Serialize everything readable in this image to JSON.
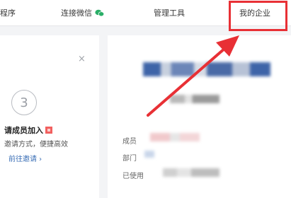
{
  "topbar": {
    "nav_miniprogram": "程序",
    "nav_wechat": "连接微信",
    "nav_tools": "管理工具",
    "nav_my_enterprise": "我的企业"
  },
  "invite_card": {
    "close": "×",
    "step": "3",
    "title": "请成员加入",
    "desc": "邀请方式，便捷高效",
    "link": "前往邀请 ›"
  },
  "enterprise_info": {
    "member_label": "成员",
    "dept_label": "部门",
    "used_label": "已使用"
  },
  "colors": {
    "accent_red": "#e83035",
    "link_blue": "#3b6fb6",
    "wechat_green": "#2aae67",
    "blur_blue": "#3e64a8"
  },
  "icons": [
    "wechat-icon",
    "close-icon",
    "red-arrow-icon"
  ]
}
